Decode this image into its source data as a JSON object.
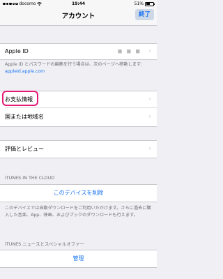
{
  "status": {
    "carrier": "docomo",
    "time": "19:44",
    "battery": "51%",
    "battery_level": 0.51
  },
  "nav": {
    "title": "アカウント",
    "done_label": "終了"
  },
  "account": {
    "apple_id_label": "Apple ID",
    "apple_id_masked": "■ ■ ■",
    "note_text": "Apple ID とパスワードの編集を行う場合は、次のページへ移動します: ",
    "note_link": "appleid.apple.com"
  },
  "payment": {
    "payment_label": "お支払情報",
    "country_label": "国または地域名"
  },
  "review": {
    "label": "評価とレビュー"
  },
  "itunes_cloud": {
    "header": "iTUNES IN THE CLOUD",
    "remove_device_label": "このデバイスを削除",
    "note": "このデバイスでは自動ダウンロードをご利用いただけます。さらに過去に購入した音楽、App、映画、およびブックのダウンロードも行えます。"
  },
  "newsletter": {
    "header": "iTUNES ニュースとスペシャルオファー",
    "manage_label": "管理"
  },
  "colors": {
    "accent": "#1a74f2",
    "highlight": "#e6197a",
    "background": "#efeff4"
  }
}
